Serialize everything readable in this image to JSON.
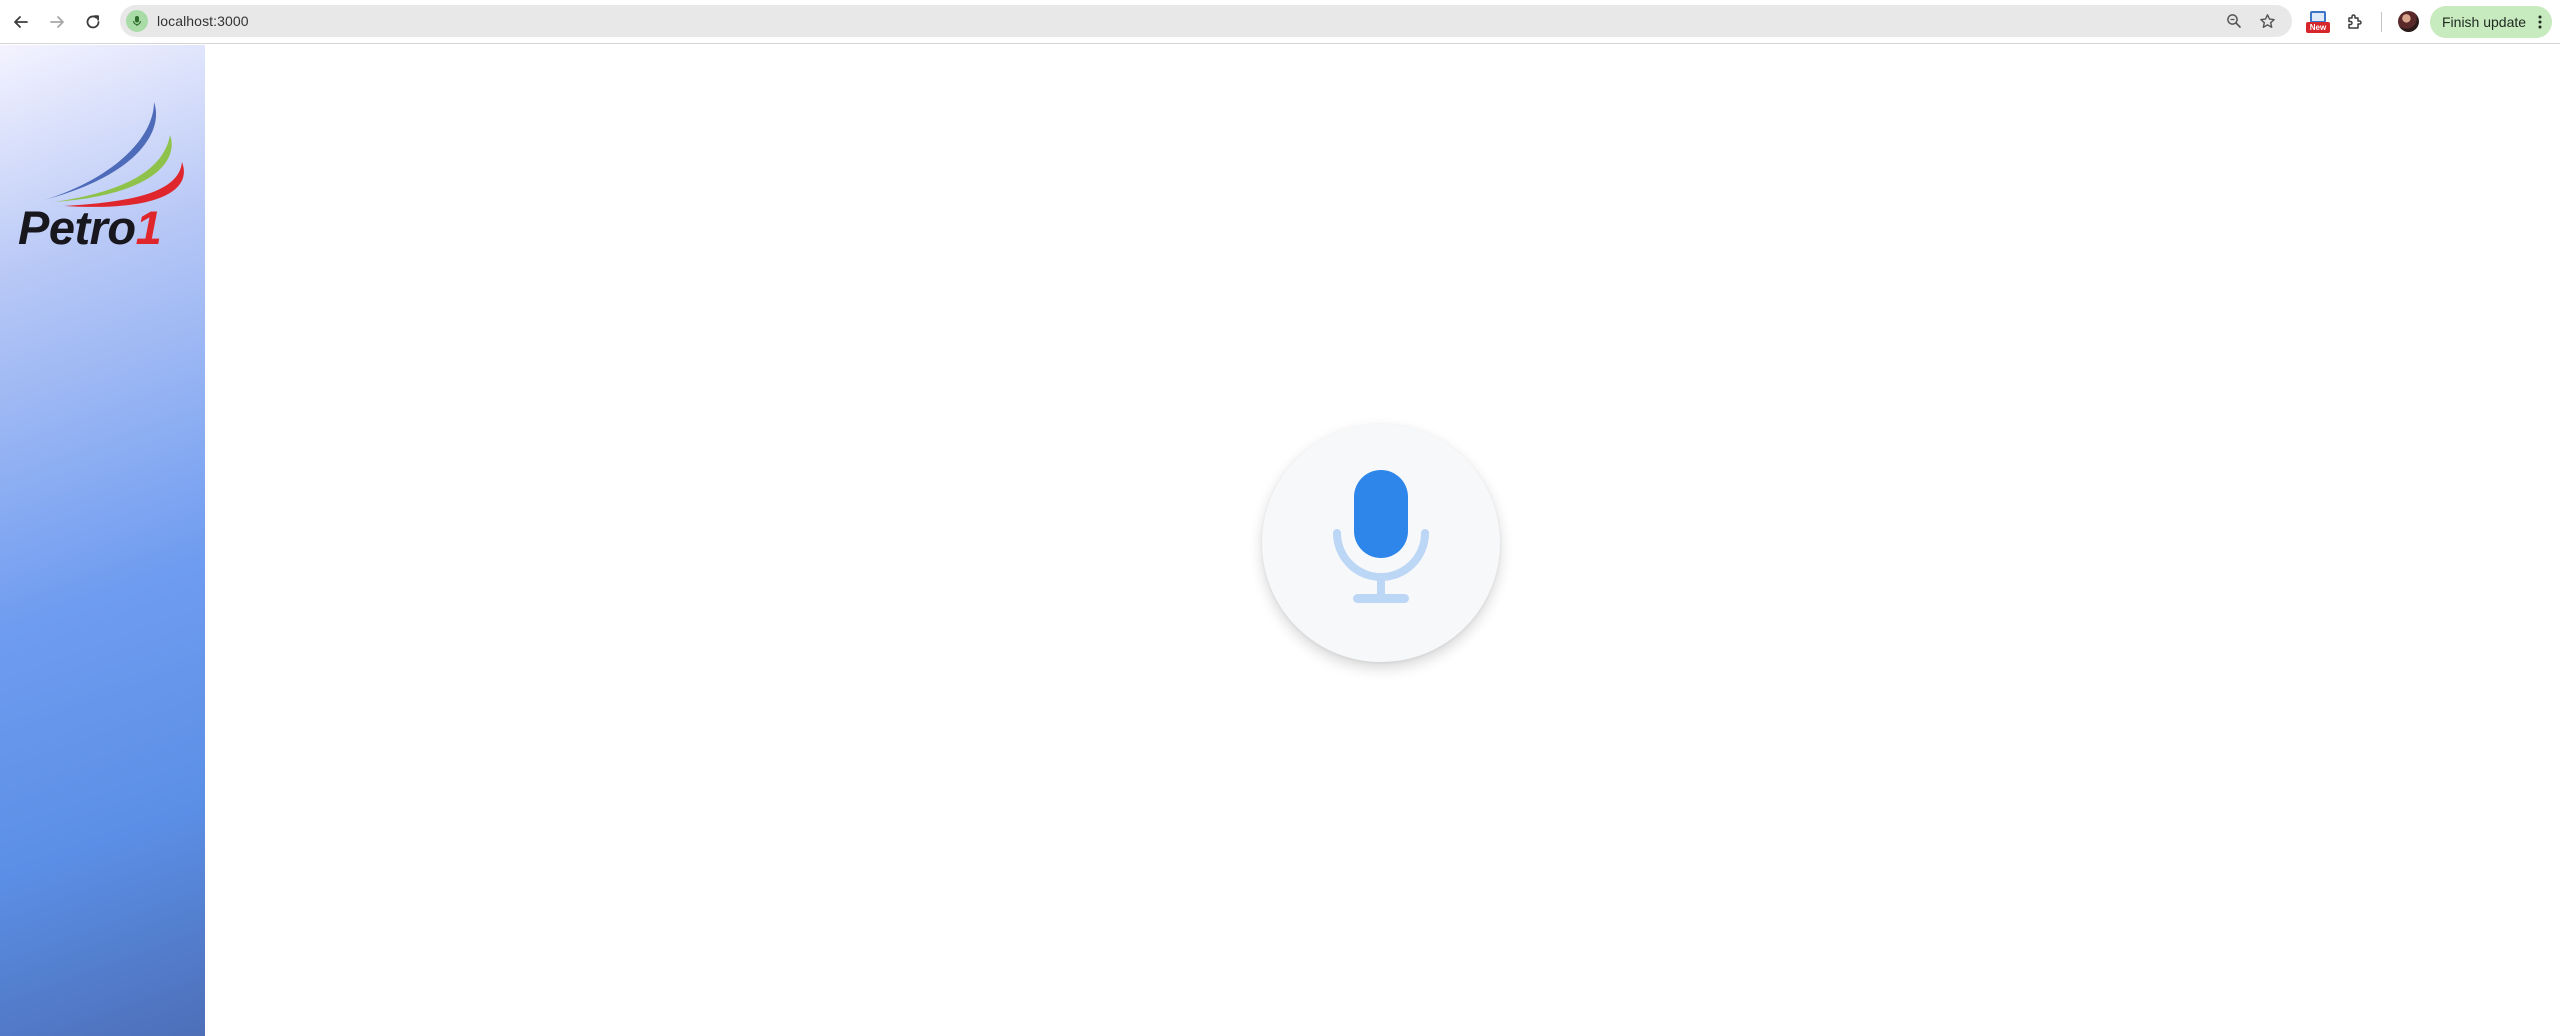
{
  "browser": {
    "url": "localhost:3000",
    "finish_update_label": "Finish update",
    "extension_badge": "New"
  },
  "sidebar": {
    "logo": {
      "text_main": "Petro",
      "text_accent": "1"
    }
  },
  "colors": {
    "mic_blue": "#2f86ea",
    "mic_stand": "#bcd6f5",
    "logo_red": "#e0262d",
    "logo_green": "#8fc24a",
    "logo_blue": "#4d6bb8"
  }
}
